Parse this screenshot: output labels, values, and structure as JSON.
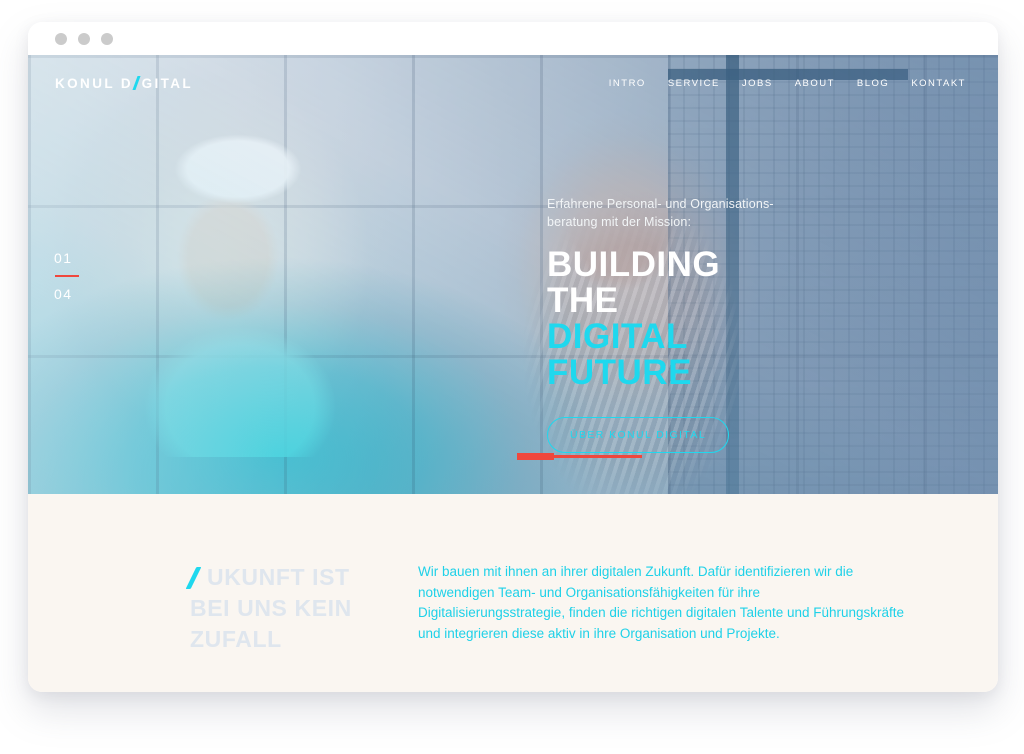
{
  "browser": {
    "dots": [
      "window-dot-1",
      "window-dot-2",
      "window-dot-3"
    ]
  },
  "header": {
    "logo_prefix": "KONUL D",
    "logo_suffix": "GITAL",
    "nav": [
      {
        "label": "INTRO"
      },
      {
        "label": "SERVICE"
      },
      {
        "label": "JOBS"
      },
      {
        "label": "ABOUT"
      },
      {
        "label": "BLOG"
      },
      {
        "label": "KONTAKT"
      }
    ]
  },
  "hero": {
    "slide_current": "01",
    "slide_total": "04",
    "kicker": "Erfahrene Personal- und Organisations-beratung mit der Mission:",
    "title_line1": "BUILDING",
    "title_line2": "THE",
    "title_line3": "DIGITAL",
    "title_line4": "FUTURE",
    "cta_label": "ÜBER KONUL DIGITAL"
  },
  "lower": {
    "heading_line1": "UKUNFT IST",
    "heading_line2": "BEI UNS KEIN",
    "heading_line3": "ZUFALL",
    "body": "Wir bauen mit ihnen an ihrer digitalen Zukunft. Dafür identifizieren wir die notwendigen Team- und Organisationsfähigkeiten für ihre Digitalisierungsstrategie, finden die richtigen digitalen Talente und Führungskräfte und integrieren diese aktiv in ihre Organisation und Projekte."
  },
  "colors": {
    "accent_cyan": "#1fd8ee",
    "accent_red": "#f0473d",
    "cream_bg": "#faf6f1",
    "heading_muted": "#dfe6ee"
  }
}
